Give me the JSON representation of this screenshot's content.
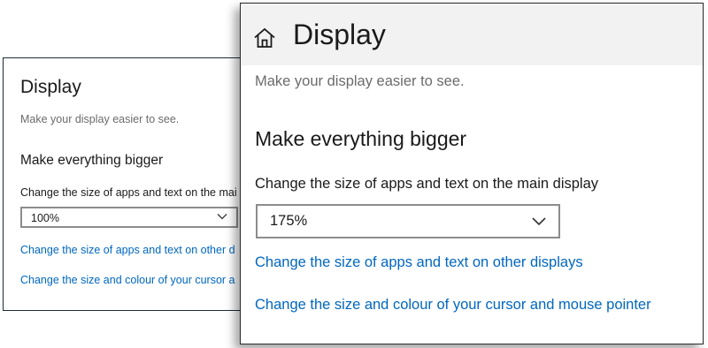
{
  "colors": {
    "link": "#0067c0",
    "text": "#1a1a1a",
    "subtext": "#6b6b6b",
    "titlebar": "#f2f2f2",
    "select_border": "#8c8c8c"
  },
  "small_window": {
    "title": "Display",
    "subtitle": "Make your display easier to see.",
    "section_heading": "Make everything bigger",
    "scale_label": "Change the size of apps and text on the mai",
    "scale_value": "100%",
    "link_other_displays": "Change the size of apps and text on other d",
    "link_cursor": "Change the size and colour of your cursor a",
    "dropdown_icon": "chevron-down-icon"
  },
  "large_window": {
    "nav_icon": "home-icon",
    "title": "Display",
    "subtitle": "Make your display easier to see.",
    "section_heading": "Make everything bigger",
    "scale_label": "Change the size of apps and text on the main display",
    "scale_value": "175%",
    "link_other_displays": "Change the size of apps and text on other displays",
    "link_cursor": "Change the size and colour of your cursor and mouse pointer",
    "dropdown_icon": "chevron-down-icon"
  }
}
